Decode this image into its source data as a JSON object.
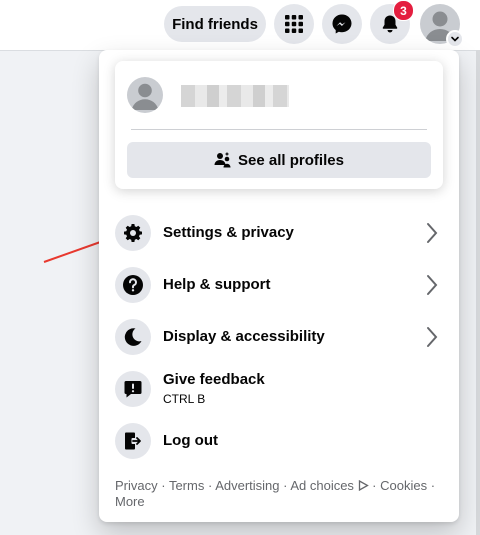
{
  "topbar": {
    "find_friends_label": "Find friends",
    "notifications_count": "3",
    "menu_icon": "grid-menu-icon",
    "messenger_icon": "messenger-icon",
    "notifications_icon": "bell-icon"
  },
  "account_menu": {
    "profile_name_hidden": "",
    "see_all_profiles_label": "See all profiles",
    "items": [
      {
        "label": "Settings & privacy",
        "icon": "gear-icon",
        "has_chevron": true
      },
      {
        "label": "Help & support",
        "icon": "question-icon",
        "has_chevron": true
      },
      {
        "label": "Display & accessibility",
        "icon": "moon-icon",
        "has_chevron": true
      },
      {
        "label": "Give feedback",
        "sublabel": "CTRL B",
        "icon": "feedback-icon",
        "has_chevron": false
      },
      {
        "label": "Log out",
        "icon": "logout-icon",
        "has_chevron": false
      }
    ],
    "footer": {
      "privacy": "Privacy",
      "terms": "Terms",
      "advertising": "Advertising",
      "ad_choices": "Ad choices",
      "cookies": "Cookies",
      "more": "More",
      "separator": " · "
    }
  },
  "colors": {
    "accent_red": "#e41e3f",
    "button_gray": "#e4e6eb",
    "annotation_arrow": "#e8392f"
  }
}
